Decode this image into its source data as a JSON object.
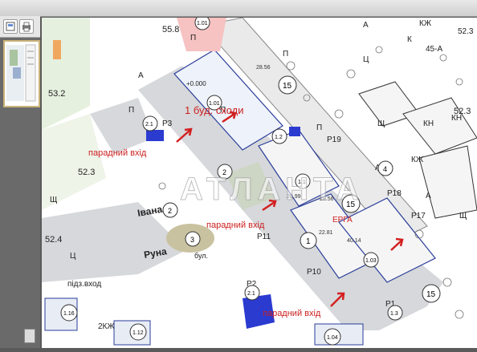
{
  "viewer": {
    "sidebar_icons": [
      "thumbnail-view-icon",
      "print-icon"
    ]
  },
  "watermark": "АТЛАНТА",
  "map": {
    "annotations": {
      "building1_stairs": "1 буд. сходи",
      "entrance_1": "парадний вхід",
      "entrance_2": "парадний вхід",
      "entrance_3": "парадний вхід"
    },
    "street_labels": {
      "street_a": "Івана",
      "street_b": "Руна",
      "street_c": "бул."
    },
    "elevations": [
      "55.8",
      "53.2",
      "52.3",
      "52.4",
      "52.3",
      "+0.000"
    ],
    "circle_labels": [
      "1.01",
      "1.01",
      "2.1",
      "1.2",
      "1.1",
      "1",
      "2",
      "2",
      "3",
      "15",
      "15",
      "15",
      "4",
      "1.16",
      "1.12",
      "1.04",
      "1.03",
      "1.3",
      "2.1"
    ],
    "code_labels": [
      "П",
      "П",
      "П",
      "П",
      "П",
      "А",
      "А",
      "А",
      "А",
      "Ц",
      "Ц",
      "Щ",
      "Щ",
      "Щ",
      "КН",
      "КН",
      "КЖ",
      "КЖ",
      "К",
      "45-А",
      "52.3",
      "Р19",
      "Р18",
      "Р17",
      "Р10",
      "Р11",
      "Р3",
      "Р2",
      "Р1",
      "ЕРГА",
      "2КЖ",
      "підз.вход",
      "28.56",
      "28.99",
      "28.56",
      "22.81",
      "40.14"
    ]
  }
}
